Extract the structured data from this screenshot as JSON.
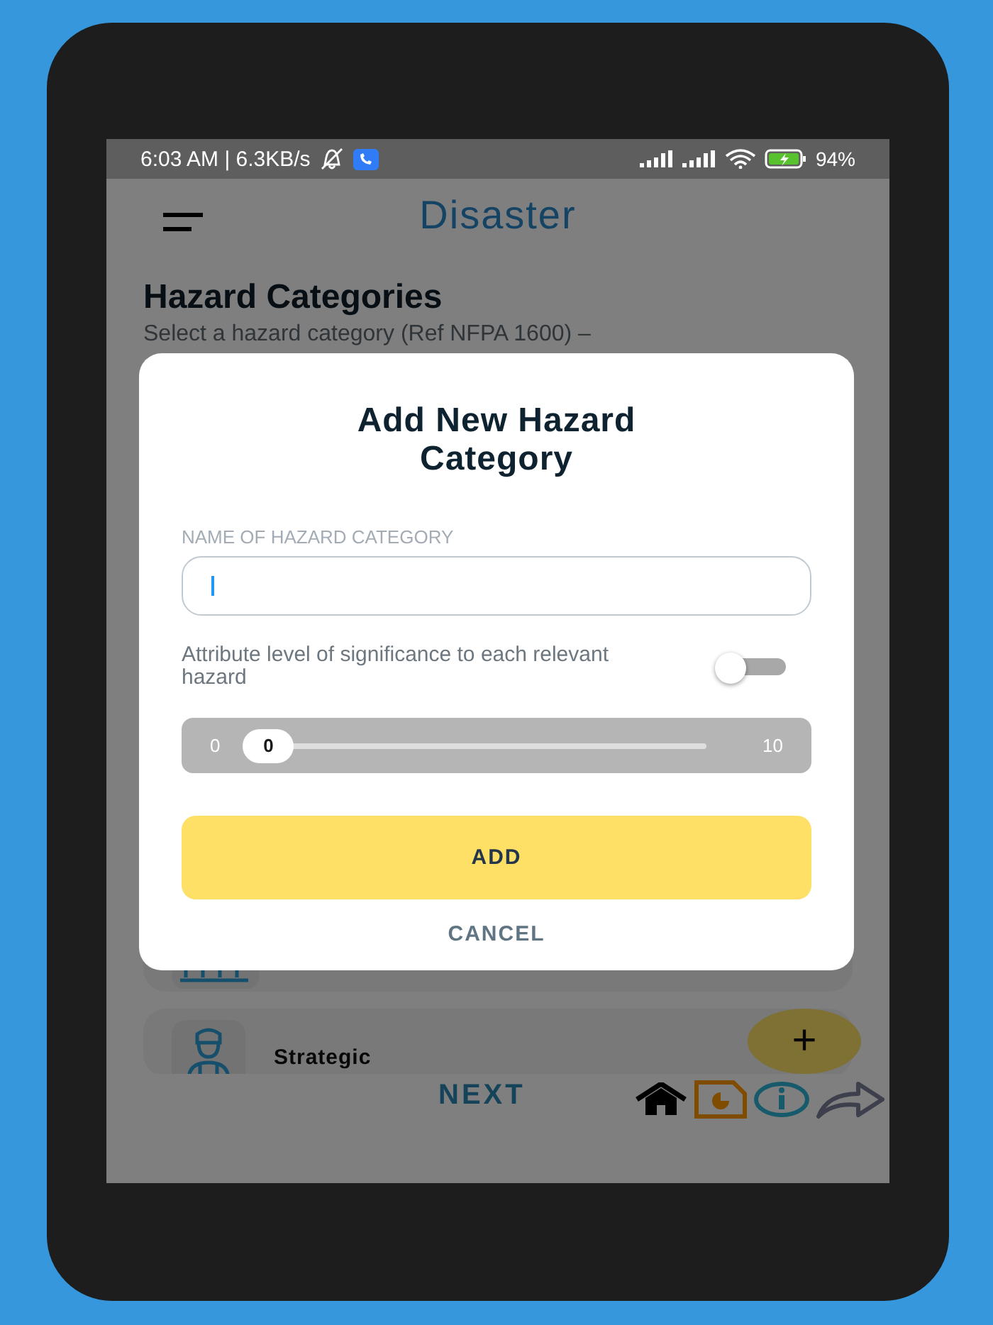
{
  "status_bar": {
    "time": "6:03 AM | 6.3KB/s",
    "battery": "94%"
  },
  "app_bar": {
    "title": "Disaster"
  },
  "page": {
    "heading": "Hazard Categories",
    "subtitle": "Select a hazard category (Ref NFPA 1600) –"
  },
  "categories": [
    {
      "kind": "building"
    },
    {
      "kind": "person",
      "name": "Strategic"
    }
  ],
  "dialog": {
    "title": "Add New Hazard Category",
    "field_label": "NAME OF HAZARD CATEGORY",
    "toggle_label": "Attribute level of significance to each relevant hazard",
    "toggle_on": false,
    "slider": {
      "min": "0",
      "max": "10",
      "value": "0",
      "level": 0
    },
    "add": "ADD",
    "cancel": "CANCEL"
  },
  "bottom_bar": {
    "next": "NEXT"
  },
  "fab": {
    "label": "+"
  }
}
